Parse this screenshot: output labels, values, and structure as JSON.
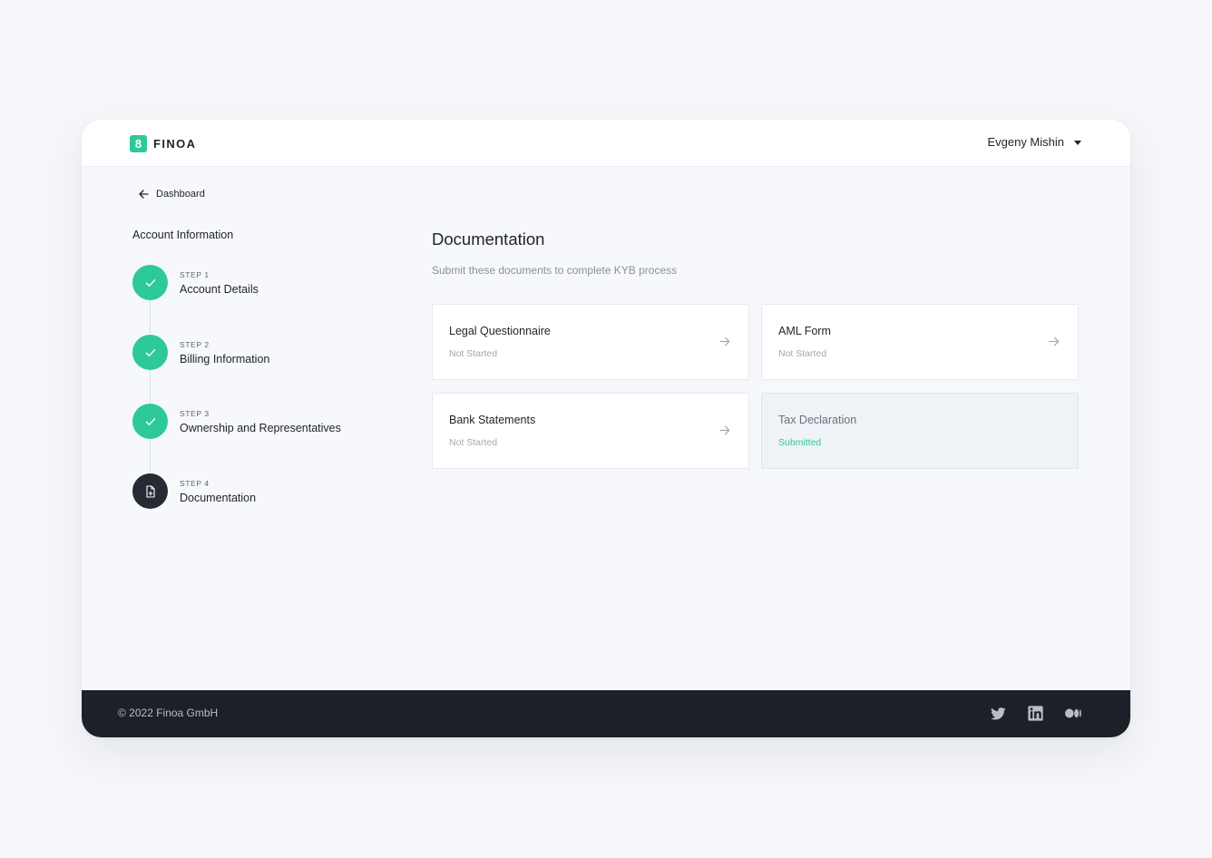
{
  "header": {
    "logo_text": "FINOA",
    "logo_glyph": "8",
    "user_name": "Evgeny Mishin"
  },
  "nav": {
    "back_label": "Dashboard"
  },
  "sidebar": {
    "title": "Account Information",
    "steps": [
      {
        "num": "STEP 1",
        "name": "Account Details",
        "state": "done"
      },
      {
        "num": "STEP 2",
        "name": "Billing Information",
        "state": "done"
      },
      {
        "num": "STEP 3",
        "name": "Ownership and Representatives",
        "state": "done"
      },
      {
        "num": "STEP 4",
        "name": "Documentation",
        "state": "current"
      }
    ]
  },
  "main": {
    "title": "Documentation",
    "subtitle": "Submit these documents to complete KYB process",
    "cards": [
      {
        "title": "Legal Questionnaire",
        "status": "Not Started"
      },
      {
        "title": "AML Form",
        "status": "Not Started"
      },
      {
        "title": "Bank Statements",
        "status": "Not Started"
      },
      {
        "title": "Tax Declaration",
        "status": "Submitted"
      }
    ]
  },
  "footer": {
    "copyright": "© 2022 Finoa GmbH",
    "social": [
      "twitter-icon",
      "linkedin-icon",
      "medium-icon"
    ]
  },
  "colors": {
    "accent": "#2ec99a",
    "dark": "#1e2029",
    "background": "#f6f8fb"
  }
}
